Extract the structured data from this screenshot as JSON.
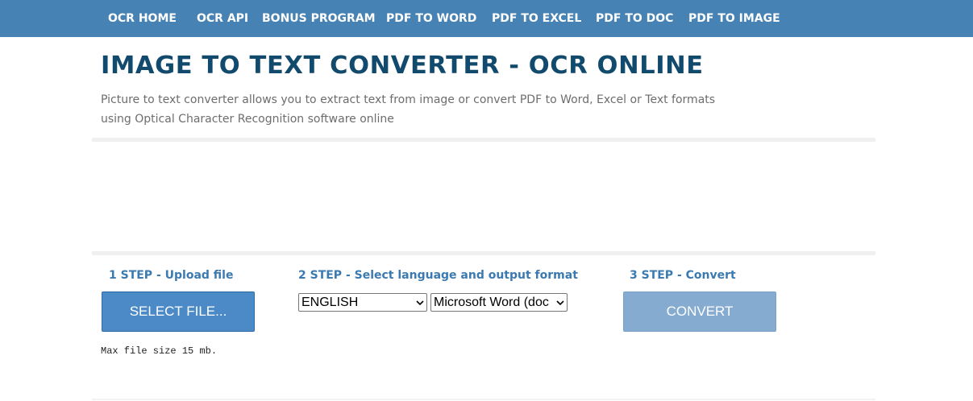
{
  "nav": {
    "items": [
      {
        "label": "OCR HOME"
      },
      {
        "label": "OCR API"
      },
      {
        "label": "BONUS PROGRAM"
      },
      {
        "label": "PDF TO WORD"
      },
      {
        "label": "PDF TO EXCEL"
      },
      {
        "label": "PDF TO DOC"
      },
      {
        "label": "PDF TO IMAGE"
      }
    ]
  },
  "header": {
    "title": "IMAGE TO TEXT CONVERTER - OCR ONLINE",
    "subtitle_line1": "Picture to text converter allows you to extract text from image or convert PDF to Word, Excel or Text formats",
    "subtitle_line2": "using Optical Character Recognition software online"
  },
  "steps": {
    "step1": {
      "label": "1 STEP - Upload file",
      "button": "SELECT FILE...",
      "note": "Max file size 15 mb."
    },
    "step2": {
      "label": "2 STEP - Select language and output format",
      "language_value": "ENGLISH",
      "format_value": "Microsoft Word (doc"
    },
    "step3": {
      "label": "3 STEP - Convert",
      "button": "CONVERT"
    }
  },
  "icons": {
    "dropdown_chevron": "chevron-down-icon"
  },
  "colors": {
    "nav_bg": "#4682b4",
    "title": "#124a6e",
    "step_label": "#3a7ab0",
    "select_button": "#4b8ac6",
    "convert_button": "#85abd1"
  }
}
